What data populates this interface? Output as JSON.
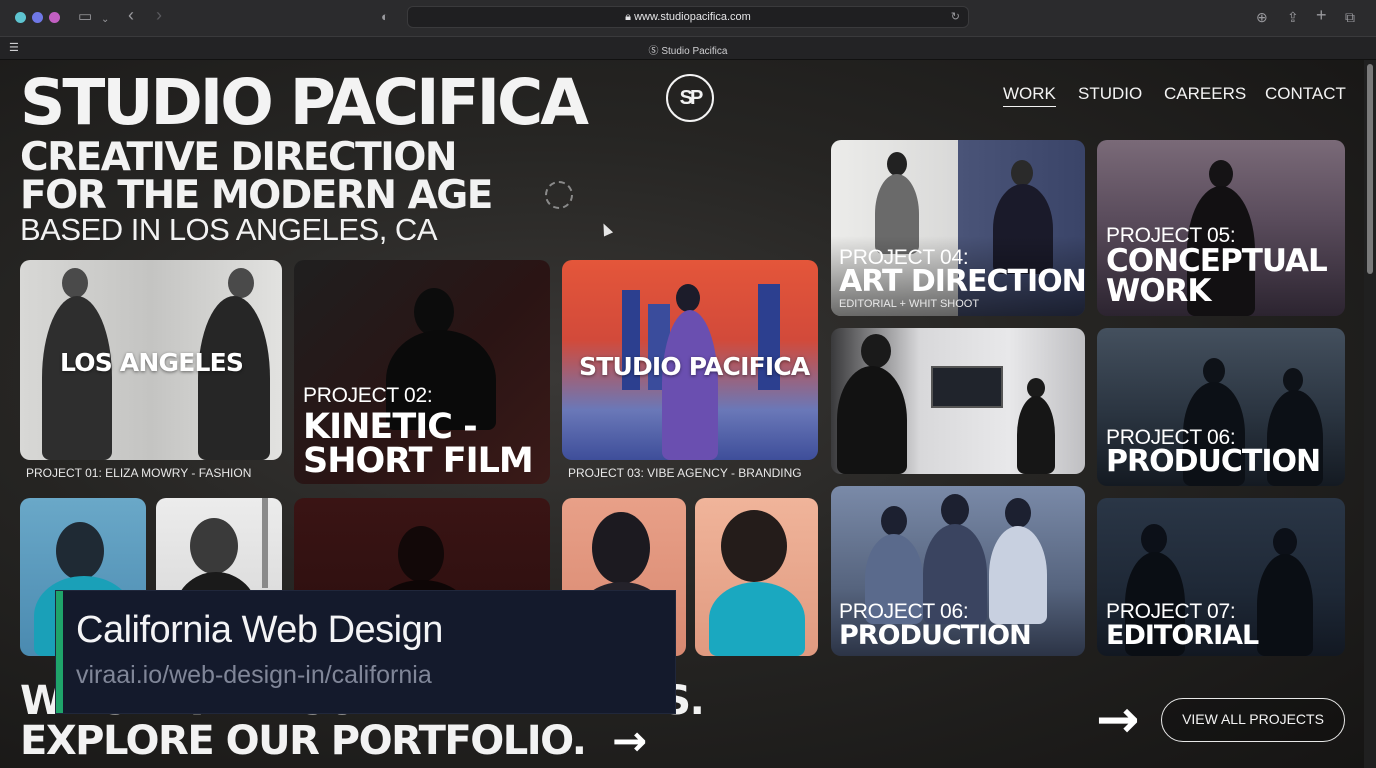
{
  "browser": {
    "url": "www.studiopacifica.com",
    "tab_title": "Studio Pacifica"
  },
  "header": {
    "brand": "STUDIO PACIFICA",
    "logo_text": "SP",
    "nav": [
      "WORK",
      "STUDIO",
      "CAREERS",
      "CONTACT"
    ],
    "active_nav": "WORK"
  },
  "hero": {
    "line1": "CREATIVE DIRECTION",
    "line2": "FOR THE MODERN AGE",
    "based": "BASED IN LOS ANGELES, CA"
  },
  "projects": {
    "p1": {
      "overlay": "LOS ANGELES",
      "caption": "PROJECT 01: ELIZA MOWRY - FASHION"
    },
    "p2": {
      "number": "PROJECT 02:",
      "title1": "KINETIC -",
      "title2": "SHORT FILM"
    },
    "p3": {
      "overlay": "STUDIO PACIFICA",
      "caption": "PROJECT 03: VIBE AGENCY - BRANDING"
    },
    "p4": {
      "number": "PROJECT 04:",
      "title": "ART DIRECTION",
      "subtitle": "EDITORIAL + WHIT SHOOT"
    },
    "p5": {
      "number": "PROJECT 05:",
      "title1": "CONCEPTUAL",
      "title2": "WORK"
    },
    "p6": {
      "number": "PROJECT 06:",
      "title": "PRODUCTION"
    },
    "p6b": {
      "number": "PROJECT 06:",
      "title": "PRODUCTION"
    },
    "p7": {
      "number": "PROJECT 07:",
      "title": "EDITORIAL"
    }
  },
  "bottom": {
    "line1": "WE SHAPE VISUAL NARRATIVES.",
    "line2": "EXPLORE OUR PORTFOLIO.",
    "arrow": "→",
    "view_all": "VIEW ALL PROJECTS"
  },
  "overlay": {
    "title": "California Web Design",
    "url": "viraai.io/web-design-in/california"
  },
  "colors": {
    "accent_green": "#1fa46a",
    "overlay_bg": "#141a2c"
  }
}
